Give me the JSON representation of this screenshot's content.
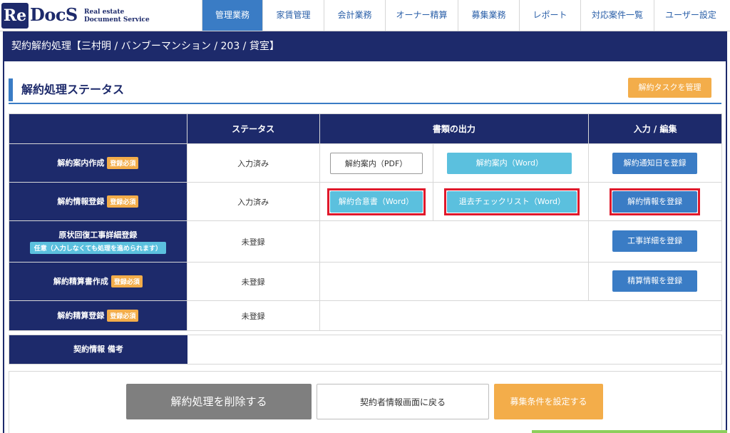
{
  "logo": {
    "mark": "Re",
    "brand": "DocS",
    "tagline_1": "Real estate",
    "tagline_2": "Document Service"
  },
  "nav": [
    {
      "label": "管理業務",
      "active": true
    },
    {
      "label": "家賃管理",
      "active": false
    },
    {
      "label": "会計業務",
      "active": false
    },
    {
      "label": "オーナー精算",
      "active": false
    },
    {
      "label": "募集業務",
      "active": false
    },
    {
      "label": "レポート",
      "active": false
    },
    {
      "label": "対応案件一覧",
      "active": false
    },
    {
      "label": "ユーザー設定",
      "active": false
    }
  ],
  "page_title": "契約解約処理【三村明 / バンブーマンション / 203 / 貸室】",
  "section": {
    "title": "解約処理ステータス",
    "manage_tasks": "解約タスクを管理"
  },
  "table": {
    "headers": {
      "blank": "",
      "status": "ステータス",
      "docs": "書類の出力",
      "edit": "入力 / 編集"
    },
    "rows": [
      {
        "label": "解約案内作成",
        "badge": "登録必須",
        "status": "入力済み",
        "doc1": "解約案内（PDF）",
        "doc2": "解約案内（Word）",
        "action": "解約通知日を登録"
      },
      {
        "label": "解約情報登録",
        "badge": "登録必須",
        "status": "入力済み",
        "doc1": "解約合意書（Word）",
        "doc2": "退去チェックリスト（Word）",
        "action": "解約情報を登録"
      },
      {
        "label": "原状回復工事詳細登録",
        "optional": "任意（入力しなくても処理を進められます）",
        "status": "未登録",
        "action": "工事詳細を登録"
      },
      {
        "label": "解約精算書作成",
        "badge": "登録必須",
        "status": "未登録",
        "action": "精算情報を登録"
      },
      {
        "label": "解約精算登録",
        "badge": "登録必須",
        "status": "未登録"
      }
    ]
  },
  "remarks": {
    "label": "契約情報 備考",
    "value": ""
  },
  "footer": {
    "delete": "解約処理を削除する",
    "back": "契約者情報画面に戻る",
    "recruit": "募集条件を設定する"
  },
  "colors": {
    "navy": "#1d2a6b",
    "blue": "#3a7cc5",
    "cyan": "#5bc0de",
    "orange": "#f3ad4a",
    "highlight": "#e0192b"
  }
}
